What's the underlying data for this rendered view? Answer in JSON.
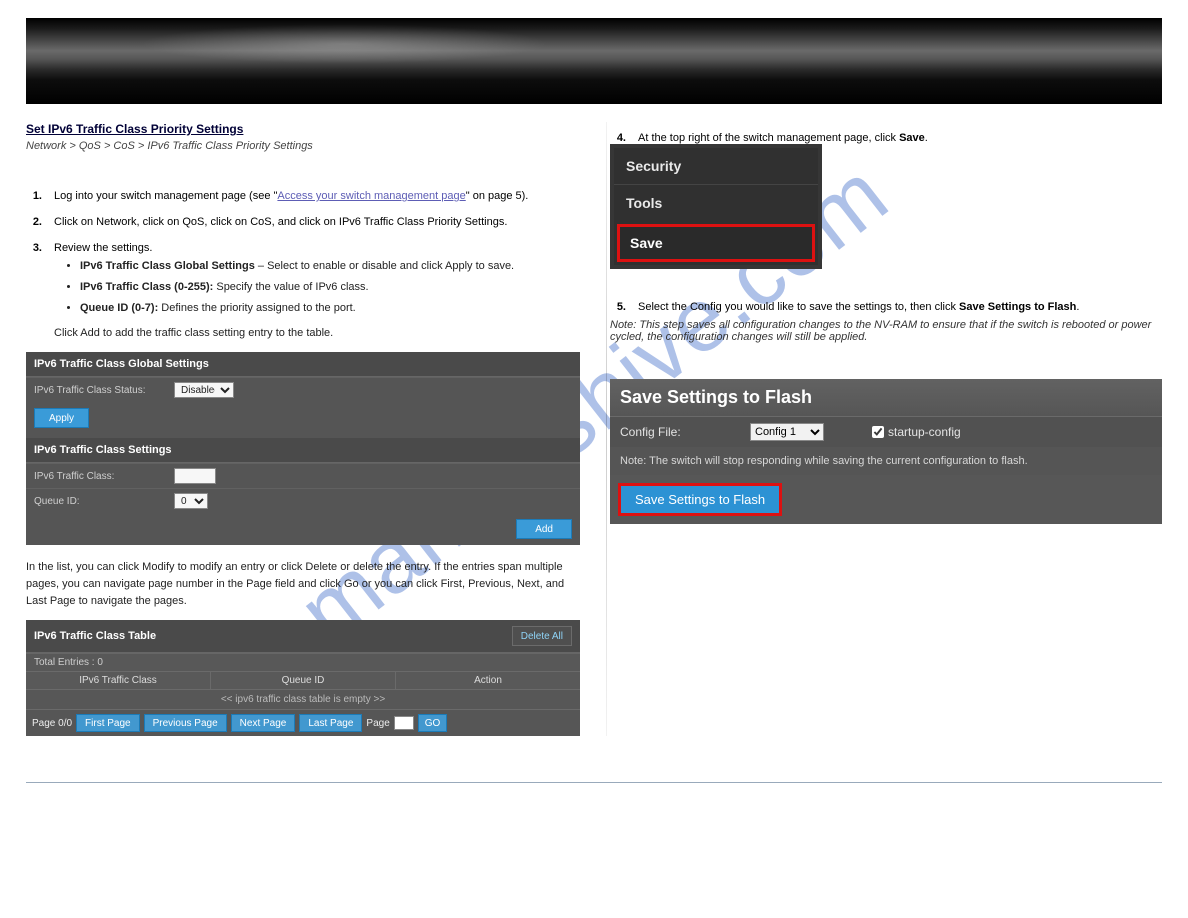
{
  "watermark_text": "manualshive.com",
  "left": {
    "h_link": "Set IPv6 Traffic Class Priority Settings",
    "sub_path": "Network > QoS > CoS > IPv6 Traffic Class Priority Settings",
    "step1_prefix": "Log into your switch management page (see \"",
    "step1_link": "Access your switch management page",
    "step1_suffix": "\" on page 5).",
    "step2": "Click on Network, click on QoS, click on CoS, and click on IPv6 Traffic Class Priority Settings.",
    "step3_intro": "Review the settings.",
    "bullet1_strong": "IPv6 Traffic Class Global Settings",
    "bullet1_rest": " – Select to enable or disable and click Apply to save.",
    "bullet2_strong": "IPv6 Traffic Class (0-255):",
    "bullet2_rest": " Specify the value of IPv6 class.",
    "bullet3_strong": "Queue ID (0-7):",
    "bullet3_rest": " Defines the priority assigned to the port.",
    "p_add": "Click Add to add the traffic class setting entry to the table.",
    "p_delete": "In the list, you can click Modify to modify an entry or click Delete or delete the entry. If the entries span multiple pages, you can navigate page number in the Page field and click Go or you can click First, Previous, Next, and Last Page to navigate the pages.",
    "sw1": {
      "title1": "IPv6 Traffic Class Global Settings",
      "row1_label": "IPv6 Traffic Class Status:",
      "row1_value": "Disabled",
      "apply": "Apply",
      "title2": "IPv6 Traffic Class Settings",
      "row2_label": "IPv6 Traffic Class:",
      "row3_label": "Queue ID:",
      "row3_value": "0",
      "add": "Add"
    },
    "sw2": {
      "title": "IPv6 Traffic Class Table",
      "delete_all": "Delete All",
      "total_entries": "Total Entries : 0",
      "col1": "IPv6 Traffic Class",
      "col2": "Queue ID",
      "col3": "Action",
      "empty": "<< ipv6 traffic class table is empty >>",
      "page_pos": "Page 0/0",
      "first": "First Page",
      "prev": "Previous Page",
      "next": "Next Page",
      "last": "Last Page",
      "page_label": "Page",
      "go": "GO"
    }
  },
  "right": {
    "step4": "At the top right of the switch management page, click Save.",
    "nav": {
      "security": "Security",
      "tools": "Tools",
      "save": "Save"
    },
    "step5": "Select the Config you would like to save the settings to, then click Save Settings to Flash.",
    "note": "Note: This step saves all configuration changes to the NV-RAM to ensure that if the switch is rebooted or power cycled, the configuration changes will still be applied.",
    "flash": {
      "title": "Save Settings to Flash",
      "cfg_label": "Config File:",
      "cfg_value": "Config 1",
      "startup_chk": "startup-config",
      "note": "Note: The switch will stop responding while saving the current configuration to flash.",
      "btn": "Save Settings to Flash"
    }
  }
}
